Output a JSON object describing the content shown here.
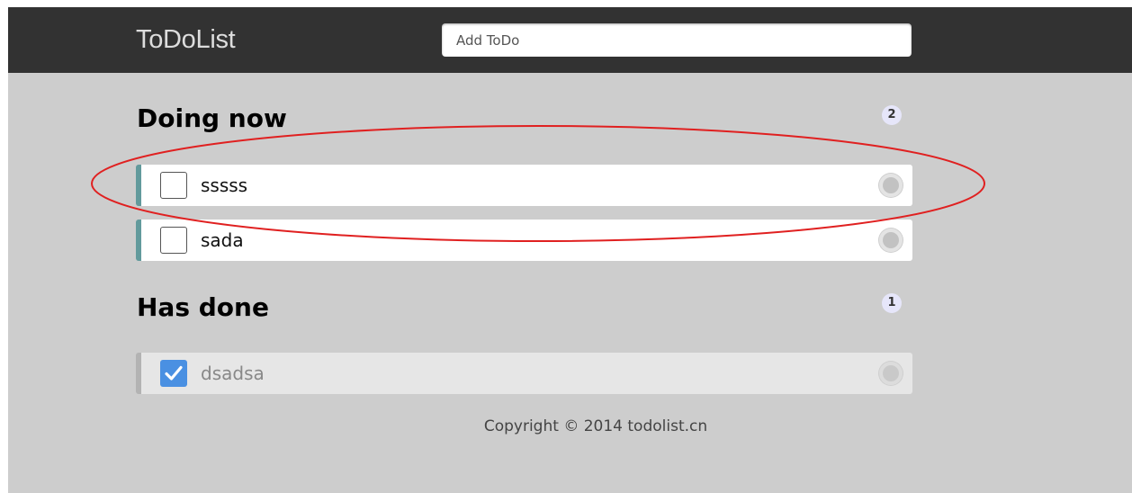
{
  "header": {
    "logo": "ToDoList",
    "add_input": {
      "placeholder": "Add ToDo",
      "value": ""
    }
  },
  "doing": {
    "title": "Doing now",
    "count": "2",
    "items": [
      {
        "text": "sssss",
        "checked": false
      },
      {
        "text": "sada",
        "checked": false
      }
    ]
  },
  "done": {
    "title": "Has done",
    "count": "1",
    "items": [
      {
        "text": "dsadsa",
        "checked": true
      }
    ]
  },
  "footer": {
    "copyright": "Copyright © 2014 todolist.cn"
  },
  "colors": {
    "header_bg": "#323232",
    "page_bg": "#cdcdcd",
    "item_accent": "#629a9c",
    "done_accent": "#b3b3b3",
    "checkbox_checked": "#4a90e2",
    "annotation": "#e02020"
  },
  "icons": {
    "item_checkbox": "checkbox-icon",
    "checked_checkbox": "checkmark-icon",
    "delete": "circle-delete-icon"
  }
}
